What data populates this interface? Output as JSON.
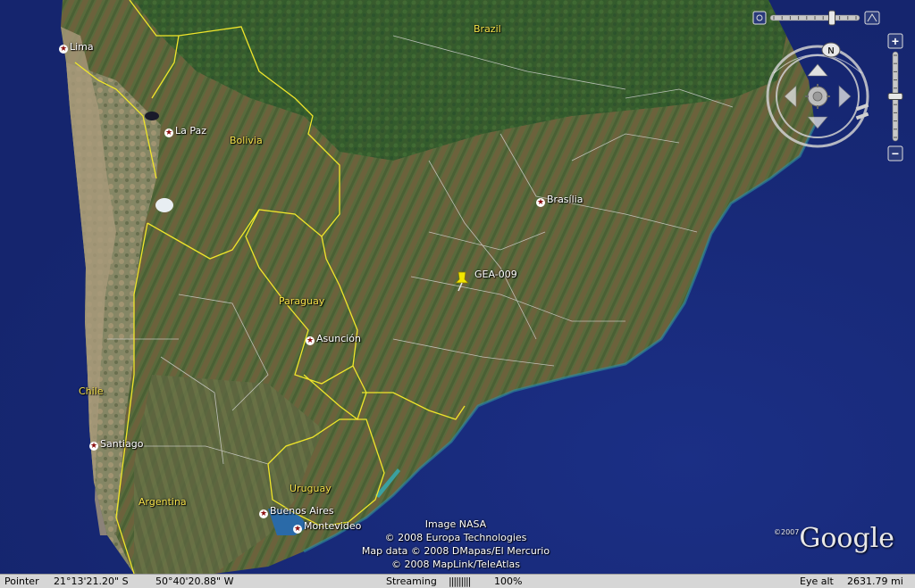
{
  "map": {
    "countries": [
      {
        "id": "brazil",
        "name": "Brazil"
      },
      {
        "id": "bolivia",
        "name": "Bolivia"
      },
      {
        "id": "paraguay",
        "name": "Paraguay"
      },
      {
        "id": "chile",
        "name": "Chile"
      },
      {
        "id": "argentina",
        "name": "Argentina"
      },
      {
        "id": "uruguay",
        "name": "Uruguay"
      }
    ],
    "cities": [
      {
        "id": "lima",
        "name": "Lima"
      },
      {
        "id": "la-paz",
        "name": "La Paz"
      },
      {
        "id": "brasilia",
        "name": "Brasília"
      },
      {
        "id": "asuncion",
        "name": "Asunción"
      },
      {
        "id": "santiago",
        "name": "Santiago"
      },
      {
        "id": "buenos-aires",
        "name": "Buenos Aires"
      },
      {
        "id": "montevideo",
        "name": "Montevideo"
      }
    ],
    "placemark": {
      "name": "GEA-009",
      "icon": "pushpin-icon",
      "color": "#f2e600"
    },
    "border_color": "#f0e62a"
  },
  "attribution": {
    "line1": "Image NASA",
    "line2": "© 2008 Europa Technologies",
    "line3": "Map data © 2008 DMapas/El Mercurio",
    "line4": "© 2008 MapLink/TeleAtlas"
  },
  "logo": {
    "copyright": "©2007",
    "text": "Google"
  },
  "navigation": {
    "compass_north": "N",
    "zoom_in": "+",
    "zoom_out": "−",
    "tilt_level": 0.69,
    "zoom_level": 0.5,
    "icons": [
      "tilt-reset-icon",
      "tilt-top-icon",
      "pan-up-icon",
      "pan-down-icon",
      "pan-left-icon",
      "pan-right-icon",
      "look-joystick-icon"
    ]
  },
  "status": {
    "pointer_label": "Pointer",
    "latitude": "21°13'21.20\" S",
    "longitude": "50°40'20.88\" W",
    "streaming_label": "Streaming",
    "streaming_bars": "|||||||||",
    "streaming_percent": "100%",
    "eye_alt_label": "Eye alt",
    "eye_alt_value": "2631.79 mi"
  }
}
